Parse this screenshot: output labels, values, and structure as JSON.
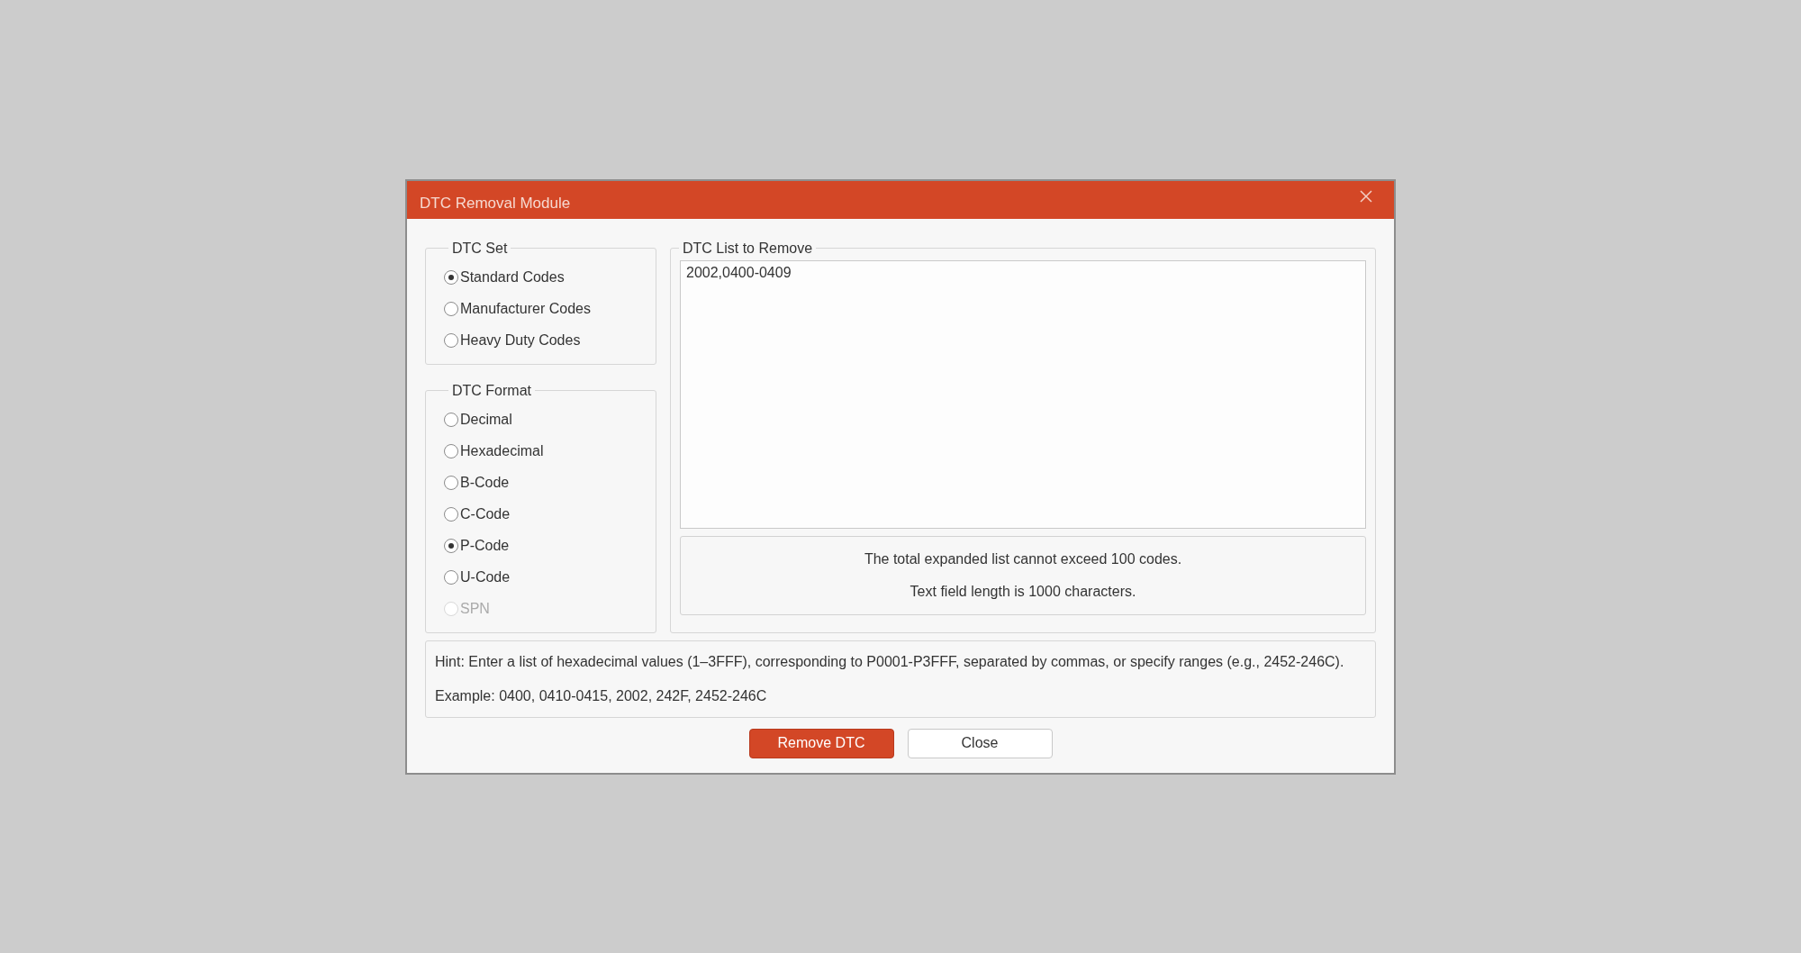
{
  "window": {
    "title": "DTC Removal Module"
  },
  "dtc_set": {
    "title": "DTC Set",
    "options": [
      {
        "label": "Standard Codes",
        "selected": true,
        "disabled": false
      },
      {
        "label": "Manufacturer Codes",
        "selected": false,
        "disabled": false
      },
      {
        "label": "Heavy Duty Codes",
        "selected": false,
        "disabled": false
      }
    ]
  },
  "dtc_format": {
    "title": "DTC Format",
    "options": [
      {
        "label": "Decimal",
        "selected": false,
        "disabled": false
      },
      {
        "label": "Hexadecimal",
        "selected": false,
        "disabled": false
      },
      {
        "label": "B-Code",
        "selected": false,
        "disabled": false
      },
      {
        "label": "C-Code",
        "selected": false,
        "disabled": false
      },
      {
        "label": "P-Code",
        "selected": true,
        "disabled": false
      },
      {
        "label": "U-Code",
        "selected": false,
        "disabled": false
      },
      {
        "label": "SPN",
        "selected": false,
        "disabled": true
      }
    ]
  },
  "dtc_list": {
    "title": "DTC List to Remove",
    "value": "2002,0400-0409",
    "notes": [
      "The total expanded list cannot exceed 100 codes.",
      "Text field length is 1000 characters."
    ]
  },
  "hint": [
    "Hint: Enter a list of hexadecimal values (1–3FFF), corresponding to P0001-P3FFF, separated by commas, or specify ranges (e.g., 2452-246C).",
    "Example: 0400, 0410-0415, 2002, 242F, 2452-246C"
  ],
  "buttons": [
    {
      "label": "Remove DTC",
      "kind": "primary"
    },
    {
      "label": "Close",
      "kind": "secondary"
    }
  ]
}
